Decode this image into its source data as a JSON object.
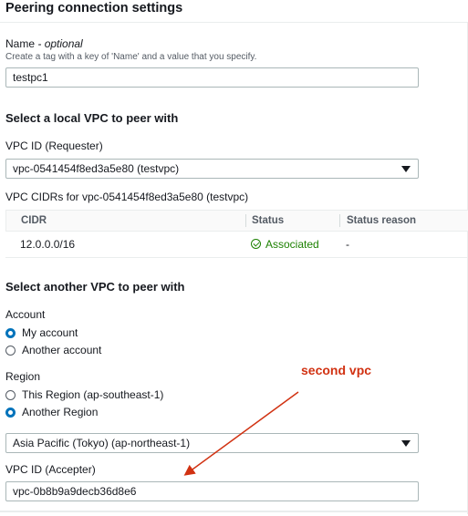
{
  "header": {
    "title": "Peering connection settings"
  },
  "name_field": {
    "label": "Name",
    "optional": "- optional",
    "hint": "Create a tag with a key of 'Name' and a value that you specify.",
    "value": "testpc1"
  },
  "local_vpc": {
    "title": "Select a local VPC to peer with",
    "vpc_id_label": "VPC ID (Requester)",
    "vpc_id_value": "vpc-0541454f8ed3a5e80 (testvpc)",
    "cidrs_label": "VPC CIDRs for vpc-0541454f8ed3a5e80 (testvpc)",
    "table": {
      "columns": [
        "CIDR",
        "Status",
        "Status reason"
      ],
      "rows": [
        {
          "cidr": "12.0.0.0/16",
          "status": "Associated",
          "reason": "-"
        }
      ]
    }
  },
  "another_vpc": {
    "title": "Select another VPC to peer with",
    "account_label": "Account",
    "account_options": [
      "My account",
      "Another account"
    ],
    "account_selected": "My account",
    "region_label": "Region",
    "region_options": [
      "This Region (ap-southeast-1)",
      "Another Region"
    ],
    "region_selected": "Another Region",
    "region_select_value": "Asia Pacific (Tokyo) (ap-northeast-1)",
    "accepter_label": "VPC ID (Accepter)",
    "accepter_value": "vpc-0b8b9a9decb36d8e6"
  },
  "annotation": {
    "text": "second vpc",
    "color": "#d13212"
  },
  "colors": {
    "accent": "#0073bb",
    "success": "#1d8102",
    "annotation": "#d13212"
  }
}
